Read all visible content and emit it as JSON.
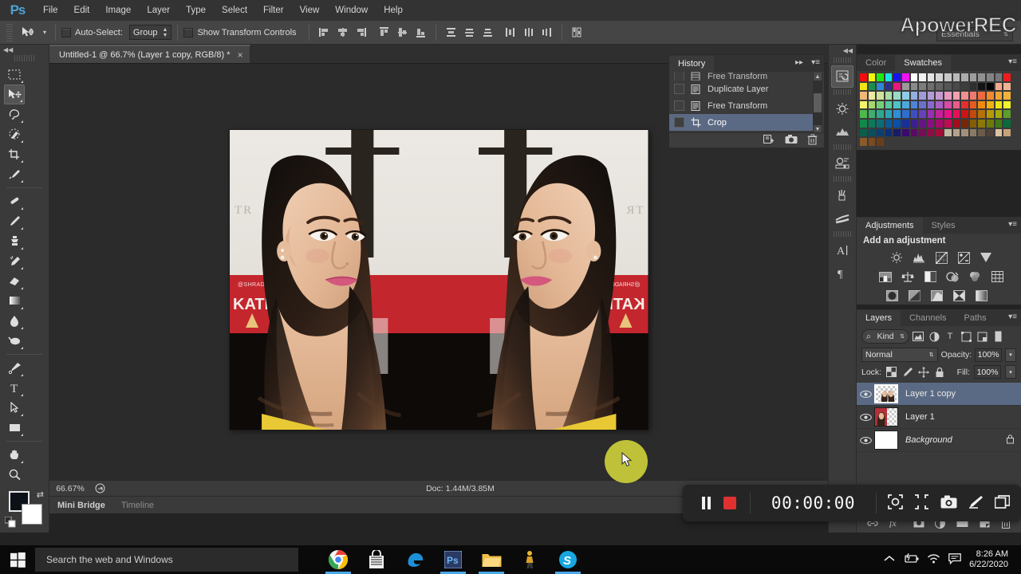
{
  "app": {
    "logo": "Ps",
    "watermark": "ApowerREC",
    "workspace": "Essentials"
  },
  "menubar": {
    "items": [
      "File",
      "Edit",
      "Image",
      "Layer",
      "Type",
      "Select",
      "Filter",
      "View",
      "Window",
      "Help"
    ]
  },
  "options_bar": {
    "tool_icon": "move-tool-icon",
    "auto_select_label": "Auto-Select:",
    "auto_select_checked": false,
    "group_value": "Group",
    "show_transform_label": "Show Transform Controls",
    "show_transform_checked": false,
    "align_icons": [
      "align-left-edges-icon",
      "align-horizontal-centers-icon",
      "align-right-edges-icon",
      "align-top-edges-icon",
      "align-vertical-centers-icon",
      "align-bottom-edges-icon",
      "distribute-top-edges-icon",
      "distribute-vertical-centers-icon",
      "distribute-bottom-edges-icon",
      "distribute-left-edges-icon",
      "distribute-horizontal-centers-icon",
      "distribute-right-edges-icon",
      "auto-align-layers-icon"
    ]
  },
  "toolbar": {
    "tools": [
      {
        "name": "rectangular-marquee-tool",
        "selected": false
      },
      {
        "name": "move-tool",
        "selected": true
      },
      {
        "name": "lasso-tool",
        "selected": false
      },
      {
        "name": "quick-selection-tool",
        "selected": false
      },
      {
        "name": "crop-tool",
        "selected": false
      },
      {
        "name": "eyedropper-tool",
        "selected": false
      },
      {
        "name": "spot-healing-brush-tool",
        "selected": false
      },
      {
        "name": "brush-tool",
        "selected": false
      },
      {
        "name": "clone-stamp-tool",
        "selected": false
      },
      {
        "name": "history-brush-tool",
        "selected": false
      },
      {
        "name": "eraser-tool",
        "selected": false
      },
      {
        "name": "gradient-tool",
        "selected": false
      },
      {
        "name": "blur-tool",
        "selected": false
      },
      {
        "name": "dodge-tool",
        "selected": false
      },
      {
        "name": "pen-tool",
        "selected": false
      },
      {
        "name": "horizontal-type-tool",
        "selected": false
      },
      {
        "name": "path-selection-tool",
        "selected": false
      },
      {
        "name": "rectangle-tool",
        "selected": false
      },
      {
        "name": "hand-tool",
        "selected": false
      },
      {
        "name": "zoom-tool",
        "selected": false
      }
    ],
    "foreground_color": "#0b1117",
    "background_color": "#ffffff",
    "bottom_tools": [
      "quick-mask-icon",
      "screen-mode-icon"
    ]
  },
  "document": {
    "tab_title": "Untitled-1 @ 66.7% (Layer 1 copy, RGB/8) *",
    "close_icon": "close-icon"
  },
  "status_bar": {
    "zoom": "66.67%",
    "doc_info": "Doc: 1.44M/3.85M",
    "arrow_icon": "play-triangle-icon"
  },
  "bottom_tabs": [
    {
      "label": "Mini Bridge",
      "active": true
    },
    {
      "label": "Timeline",
      "active": false
    }
  ],
  "rail_icons": [
    {
      "name": "history-rail-icon",
      "selected": true
    },
    {
      "name": "adjustments-brightness-rail-icon",
      "selected": false
    },
    {
      "name": "histogram-rail-icon",
      "selected": false
    },
    {
      "name": "properties-rail-icon",
      "selected": false
    },
    {
      "name": "brush-preset-rail-icon",
      "selected": false
    },
    {
      "name": "brush-settings-rail-icon",
      "selected": false
    },
    {
      "name": "character-rail-icon",
      "selected": false
    },
    {
      "name": "paragraph-rail-icon",
      "selected": false
    }
  ],
  "history_panel": {
    "tab": "History",
    "collapse_icon": "double-arrow-right-icon",
    "menu_icon": "panel-menu-icon",
    "items": [
      {
        "label": "Free Transform",
        "icon": "free-transform-icon",
        "selected": false,
        "clipped": true
      },
      {
        "label": "Duplicate Layer",
        "icon": "duplicate-layer-icon",
        "selected": false
      },
      {
        "label": "Free Transform",
        "icon": "free-transform-icon",
        "selected": false
      },
      {
        "label": "Crop",
        "icon": "crop-icon",
        "selected": true
      }
    ],
    "footer_icons": [
      "create-document-from-state-icon",
      "create-new-snapshot-icon",
      "delete-state-icon"
    ]
  },
  "swatch_panel": {
    "tabs": [
      {
        "label": "Color",
        "active": false
      },
      {
        "label": "Swatches",
        "active": true
      }
    ],
    "menu_icon": "panel-menu-icon",
    "rows": [
      [
        "#f20d0d",
        "#f5f50a",
        "#1ee814",
        "#1ae3e3",
        "#1414ef",
        "#f113f1",
        "#ffffff",
        "#f2f2f2",
        "#e3e3e3",
        "#d4d4d4",
        "#c6c6c6",
        "#b8b8b8",
        "#ababab",
        "#9e9e9e",
        "#919191",
        "#848484",
        "#787878",
        "#ef1c1c"
      ],
      [
        "#f0e512",
        "#1a8f4a",
        "#2f86d6",
        "#2c2f86",
        "#e8197d",
        "#9a9a9a",
        "#8a8a8a",
        "#7d7d7d",
        "#6f6f6f",
        "#636363",
        "#565656",
        "#4a4a4a",
        "#3d3d3d",
        "#2f2f2f",
        "#141414",
        "#050505",
        "#f2a98e",
        "#f0b393"
      ],
      [
        "#f0b978",
        "#edeba0",
        "#cfe39b",
        "#a9dca6",
        "#9ad9c8",
        "#8ecbe6",
        "#93aee0",
        "#a09ad8",
        "#b49ad4",
        "#c69ad0",
        "#e59ac0",
        "#f0a0ae",
        "#f09090",
        "#ee7a70",
        "#ef6a3c",
        "#f0892f",
        "#f0a436",
        "#f0b33a"
      ],
      [
        "#f5f36a",
        "#a7d86d",
        "#75cf7a",
        "#56c89d",
        "#4dc3c3",
        "#4aa8e0",
        "#4f83d8",
        "#6a6fd0",
        "#8a68cc",
        "#a95fc4",
        "#d94ba8",
        "#ec5a8c",
        "#e82d2d",
        "#e85b1f",
        "#ee8a12",
        "#eeb312",
        "#f0e60f",
        "#f0f22d"
      ],
      [
        "#4cb94c",
        "#3fae6d",
        "#2fa78f",
        "#2ba3b5",
        "#2f8fd6",
        "#2f6dd0",
        "#3f4fc0",
        "#6a3fbc",
        "#9a2fb4",
        "#c4219b",
        "#e8108a",
        "#e60f5a",
        "#cc1414",
        "#c24a0a",
        "#b57206",
        "#b59a06",
        "#a3ac08",
        "#5c9e2a"
      ],
      [
        "#0f8a4a",
        "#0a7a5c",
        "#0a6e78",
        "#0a5a96",
        "#0a4fa8",
        "#1a2f9a",
        "#3b1f92",
        "#6a128a",
        "#8c0f80",
        "#a80a6a",
        "#c20a52",
        "#a30c1a",
        "#7a2408",
        "#855d05",
        "#8a7a05",
        "#6e7a06",
        "#3f7a14",
        "#0a6b3a"
      ],
      [
        "#0a5f4a",
        "#0a4f5e",
        "#0a3f72",
        "#0a2f7a",
        "#1a1a6a",
        "#3a0a6e",
        "#5a0a66",
        "#7a0a58",
        "#920a46",
        "#a80a38",
        "#c4b9a3",
        "#b5a18c",
        "#a3907c",
        "#8a7a66",
        "#6b5c4a",
        "#4f4238",
        "#dcc2a0",
        "#c6a278"
      ],
      [
        "#8a5a2a",
        "#7a4a20",
        "#6b3d18"
      ]
    ]
  },
  "adjustments_panel": {
    "tabs": [
      {
        "label": "Adjustments",
        "active": true
      },
      {
        "label": "Styles",
        "active": false
      }
    ],
    "menu_icon": "panel-menu-icon",
    "title": "Add an adjustment",
    "rows": [
      [
        "brightness-contrast-icon",
        "levels-icon",
        "curves-icon",
        "exposure-icon",
        "vibrance-icon"
      ],
      [
        "hue-saturation-icon",
        "color-balance-icon",
        "black-and-white-icon",
        "photo-filter-icon",
        "channel-mixer-icon",
        "color-lookup-icon"
      ],
      [
        "invert-icon",
        "posterize-icon",
        "threshold-icon",
        "selective-color-icon",
        "gradient-map-icon"
      ]
    ]
  },
  "layers_panel": {
    "tabs": [
      {
        "label": "Layers",
        "active": true
      },
      {
        "label": "Channels",
        "active": false
      },
      {
        "label": "Paths",
        "active": false
      }
    ],
    "menu_icon": "panel-menu-icon",
    "filter_kind": "Kind",
    "filter_icons": [
      "filter-pixel-icon",
      "filter-adjustment-icon",
      "filter-type-icon",
      "filter-shape-icon",
      "filter-smart-object-icon",
      "filter-toggle-icon"
    ],
    "blend_mode": "Normal",
    "opacity_label": "Opacity:",
    "opacity_value": "100%",
    "lock_label": "Lock:",
    "lock_icons": [
      "lock-transparent-pixels-icon",
      "lock-image-pixels-icon",
      "lock-position-icon",
      "lock-all-icon"
    ],
    "fill_label": "Fill:",
    "fill_value": "100%",
    "layers": [
      {
        "name": "Layer 1 copy",
        "selected": true,
        "visible": true,
        "locked": false,
        "italic": false,
        "thumb": "mirror-thumb"
      },
      {
        "name": "Layer 1",
        "selected": false,
        "visible": true,
        "locked": false,
        "italic": false,
        "thumb": "portrait-thumb"
      },
      {
        "name": "Background",
        "selected": false,
        "visible": true,
        "locked": true,
        "italic": true,
        "thumb": "white-thumb"
      }
    ],
    "footer_icons": [
      "link-layers-icon",
      "layer-style-fx-icon",
      "add-layer-mask-icon",
      "new-fill-adjustment-icon",
      "new-group-icon",
      "new-layer-icon",
      "delete-layer-icon"
    ]
  },
  "recorder": {
    "pause_icon": "pause-icon",
    "stop_icon": "stop-icon",
    "time": "00:00:00",
    "tools": [
      "region-capture-icon",
      "minimize-icon",
      "screenshot-icon",
      "pen-annotate-icon",
      "float-window-icon"
    ]
  },
  "taskbar": {
    "start_icon": "windows-start-icon",
    "search_placeholder": "Search the web and Windows",
    "apps": [
      {
        "name": "chrome-taskbar-icon",
        "running": true
      },
      {
        "name": "store-taskbar-icon",
        "running": false
      },
      {
        "name": "edge-taskbar-icon",
        "running": false
      },
      {
        "name": "photoshop-taskbar-icon",
        "running": true
      },
      {
        "name": "file-explorer-taskbar-icon",
        "running": true
      },
      {
        "name": "app-taskbar-icon",
        "running": false
      },
      {
        "name": "skype-taskbar-icon",
        "running": true
      }
    ],
    "tray_icons": [
      "show-hidden-icons-icon",
      "battery-icon",
      "wifi-icon",
      "action-center-icon"
    ],
    "clock_time": "8:26 AM",
    "clock_date": "6/22/2020"
  }
}
